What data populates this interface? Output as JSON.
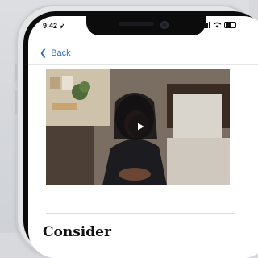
{
  "status_bar": {
    "time": "9:42",
    "location_icon": "location-arrow-icon",
    "signal_icon": "cellular-signal-icon",
    "wifi_icon": "wifi-icon",
    "battery_icon": "battery-icon"
  },
  "nav": {
    "back_label": "Back",
    "back_icon": "chevron-left-icon"
  },
  "video": {
    "play_icon": "play-icon"
  },
  "article": {
    "heading": "Consider"
  },
  "colors": {
    "link": "#2e6fb8",
    "background": "#d7d9dc",
    "screen": "#ffffff"
  }
}
